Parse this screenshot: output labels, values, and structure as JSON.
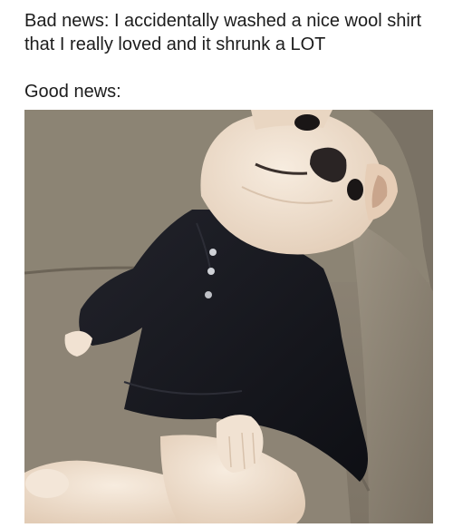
{
  "post": {
    "caption": "Bad news: I accidentally washed a nice wool shirt that I really loved and it shrunk a LOT",
    "subcaption": "Good news:"
  },
  "photo": {
    "subject": "french-bulldog-in-black-shirt",
    "colors": {
      "couch": "#8f8677",
      "couch_dark": "#6f675a",
      "dog_fur": "#f1e2d2",
      "shirt": "#15161c"
    }
  }
}
